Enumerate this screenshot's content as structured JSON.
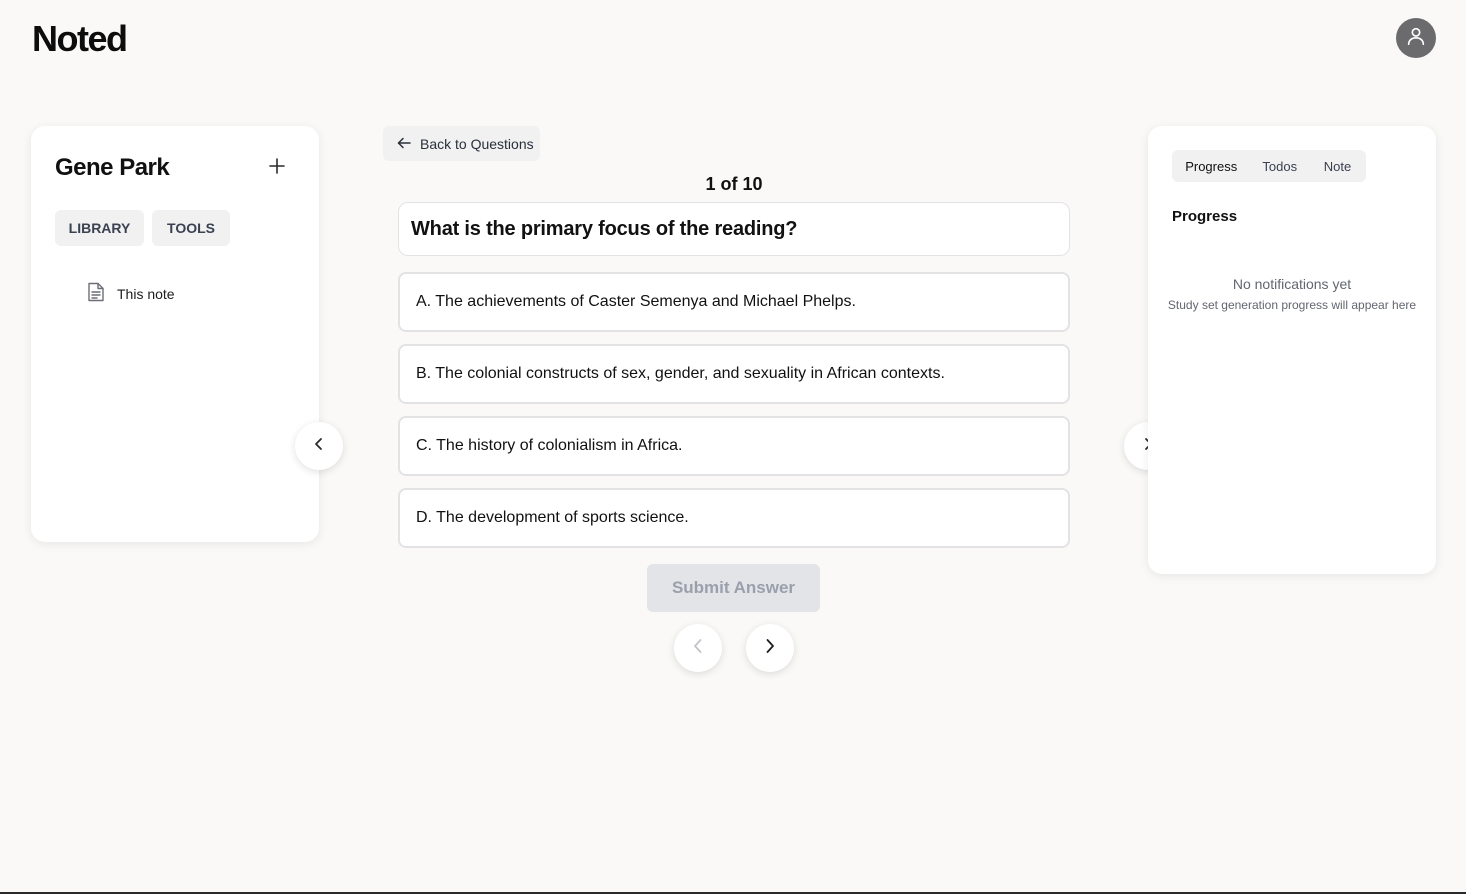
{
  "app": {
    "title": "Noted"
  },
  "user": {
    "avatar_icon": "user-icon"
  },
  "sidebar": {
    "title": "Gene Park",
    "add_icon": "plus-icon",
    "tabs": [
      {
        "label": "LIBRARY"
      },
      {
        "label": "TOOLS"
      }
    ],
    "items": [
      {
        "label": "This note",
        "icon": "document-icon"
      }
    ]
  },
  "quiz": {
    "back_label": "Back to Questions",
    "counter": "1 of 10",
    "question": "What is the primary focus of the reading?",
    "options": [
      {
        "label": "A. The achievements of Caster Semenya and Michael Phelps."
      },
      {
        "label": "B. The colonial constructs of sex, gender, and sexuality in African contexts."
      },
      {
        "label": "C. The history of colonialism in Africa."
      },
      {
        "label": "D. The development of sports science."
      }
    ],
    "submit_label": "Submit Answer"
  },
  "right_panel": {
    "tabs": [
      {
        "label": "Progress",
        "active": true
      },
      {
        "label": "Todos",
        "active": false
      },
      {
        "label": "Note",
        "active": false
      }
    ],
    "heading": "Progress",
    "empty_title": "No notifications yet",
    "empty_subtitle": "Study set generation progress will appear here"
  },
  "colors": {
    "background": "#faf9f7",
    "card": "#ffffff",
    "pill": "#f1f1f2",
    "avatar": "#6b6b6e",
    "submit_disabled_bg": "#e3e4e8",
    "submit_disabled_text": "#9aa0ab"
  }
}
